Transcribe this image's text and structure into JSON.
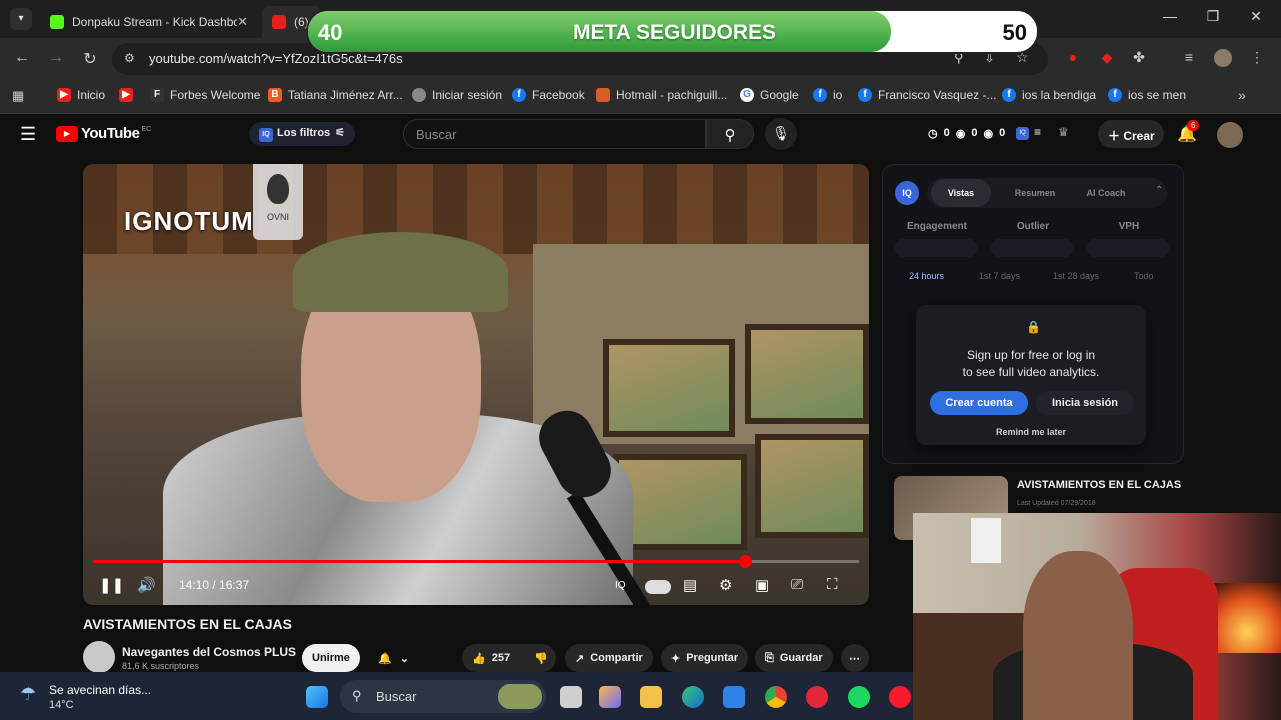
{
  "browser": {
    "tabs": [
      {
        "label": "Donpaku Stream - Kick Dashbo",
        "close": "✕"
      },
      {
        "label": "(6)",
        "close": ""
      }
    ],
    "window_controls": {
      "minimize": "—",
      "maximize": "❐",
      "close": "✕"
    },
    "url": "youtube.com/watch?v=YfZozI1tG5c&t=476s"
  },
  "bookmarks": [
    {
      "label": "Inicio",
      "color": "#e62117"
    },
    {
      "label": "",
      "color": "#e62117"
    },
    {
      "label": "Forbes Welcome",
      "color": "#333333"
    },
    {
      "label": "Tatiana Jiménez Arr...",
      "color": "#f05a28"
    },
    {
      "label": "Iniciar sesión",
      "color": "#888888"
    },
    {
      "label": "Facebook",
      "color": "#1877f2"
    },
    {
      "label": "Hotmail - pachiguill...",
      "color": "#d65c2a"
    },
    {
      "label": "Google",
      "color": "#ffffff"
    },
    {
      "label": "io",
      "color": "#1877f2"
    },
    {
      "label": "Francisco Vasquez -...",
      "color": "#1877f2"
    },
    {
      "label": "ios la bendiga",
      "color": "#1877f2"
    },
    {
      "label": "ios se men",
      "color": "#1877f2"
    }
  ],
  "youtube": {
    "logo": "YouTube",
    "region": "EC",
    "filters_label": "Los filtros",
    "search_placeholder": "Buscar",
    "counters": [
      "0",
      "0",
      "0"
    ],
    "create_label": "Crear",
    "notif_count": "6"
  },
  "meta_bar": {
    "start": "40",
    "title": "META SEGUIDORES",
    "goal": "50",
    "progress": 0.8
  },
  "video": {
    "brand": "IGNOTUM",
    "badge": "OVNI",
    "time": "14:10 / 16:37",
    "progress": 0.851,
    "title": "AVISTAMIENTOS EN EL CAJAS"
  },
  "channel": {
    "name": "Navegantes del Cosmos PLUS",
    "subs": "81,6 K suscriptores",
    "join": "Unirme",
    "likes": "257",
    "share": "Compartir",
    "ask": "Preguntar",
    "save": "Guardar"
  },
  "analytics": {
    "tabs": [
      "Vistas",
      "Resumen",
      "AI Coach"
    ],
    "metrics": [
      "Engagement",
      "Outlier",
      "VPH"
    ],
    "ranges": [
      "24 hours",
      "1st 7 days",
      "1st 28 days",
      "Todo"
    ],
    "popup_text_1": "Sign up for free or log in",
    "popup_text_2": "to see full video analytics.",
    "create_account": "Crear cuenta",
    "login": "Inicia sesión",
    "remind": "Remind me later"
  },
  "suggested": {
    "title": "AVISTAMIENTOS EN EL CAJAS",
    "date": "Last Updated 07/29/2018"
  },
  "taskbar": {
    "weather_text": "Se avecinan días...",
    "temperature": "14°C",
    "search": "Buscar"
  }
}
